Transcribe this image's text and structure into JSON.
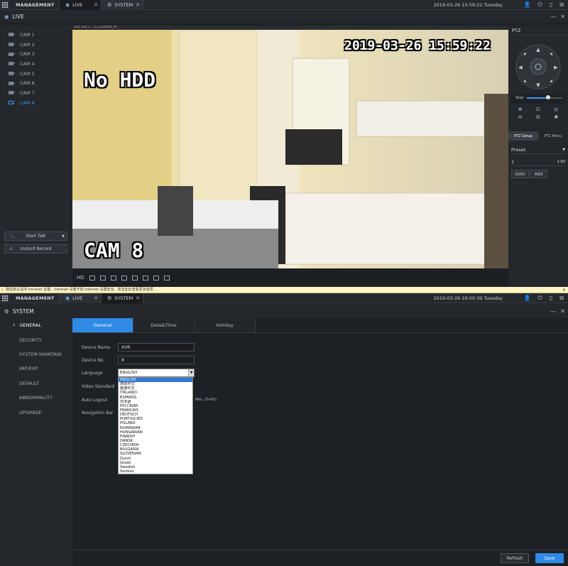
{
  "top": {
    "management_tab": "MANAGEMENT",
    "live_tab": "LIVE",
    "system_tab": "SYSTEM",
    "datetime": "2019-03-26 15:59:22 Tuesday"
  },
  "live": {
    "title": "LIVE",
    "cameras": [
      "CAM 1",
      "CAM 2",
      "CAM 3",
      "CAM 4",
      "CAM 5",
      "CAM 6",
      "CAM 7",
      "CAM 8"
    ],
    "selected_camera": "CAM 8",
    "start_talk": "Start Talk",
    "instant_record": "Instant Record",
    "stream_info": "192.168.1.7_8_310Kbps_M",
    "osd_datetime": "2019-03-26 15:59:22",
    "osd_status": "No HDD",
    "osd_channel": "CAM 8",
    "hd_label": "HD"
  },
  "ptz": {
    "title": "PTZ",
    "step_label": "Step",
    "setup_tab": "PTZ Setup",
    "menu_tab": "PTZ Menu",
    "preset_label": "Preset",
    "preset_value": "1",
    "preset_range": "1-80",
    "goto": "Goto",
    "add": "Add"
  },
  "notification": "我在默认关闭 Intranet 设置。Intranet 设置不如 Internet 设置安全。单击此处查看更多选项...",
  "system": {
    "top": {
      "management_tab": "MANAGEMENT",
      "live_tab": "LIVE",
      "system_tab": "SYSTEM",
      "datetime": "2019-03-26 16:00:39 Tuesday"
    },
    "title": "SYSTEM",
    "menu": [
      "GENERAL",
      "SECURITY",
      "SYSTEM MAINTAIN",
      "IMP/EXP",
      "DEFAULT",
      "ABNORMALITY",
      "UPGRADE"
    ],
    "tabs": [
      "General",
      "Date&Time",
      "Holiday"
    ],
    "fields": {
      "device_name_label": "Device Name",
      "device_name_value": "XVR",
      "device_no_label": "Device No.",
      "device_no_value": "8",
      "language_label": "Language",
      "language_value": "ENGLISH",
      "video_standard_label": "Video Standard",
      "auto_logout_label": "Auto Logout",
      "auto_logout_unit": "Min. (0-60)",
      "navigation_bar_label": "Navigation Bar"
    },
    "languages": [
      "ENGLISH",
      "简体中文",
      "繁體中文",
      "ITALIANO",
      "ESPAÑOL",
      "日本語",
      "РУССКИЙ",
      "FRANCAIS",
      "DEUTSCH",
      "PORTUGUÊS",
      "POLAND",
      "ROMANIAN",
      "HUNGARIAN",
      "FINNISH",
      "DANSK",
      "CZECHISH",
      "BULGARIA",
      "SLOVENIAN",
      "Dutch",
      "Greek",
      "Swedish",
      "Serbian"
    ],
    "refresh": "Refresh",
    "save": "Save"
  },
  "colors": {
    "accent": "#2f8ae6",
    "selected": "#3377d6"
  }
}
